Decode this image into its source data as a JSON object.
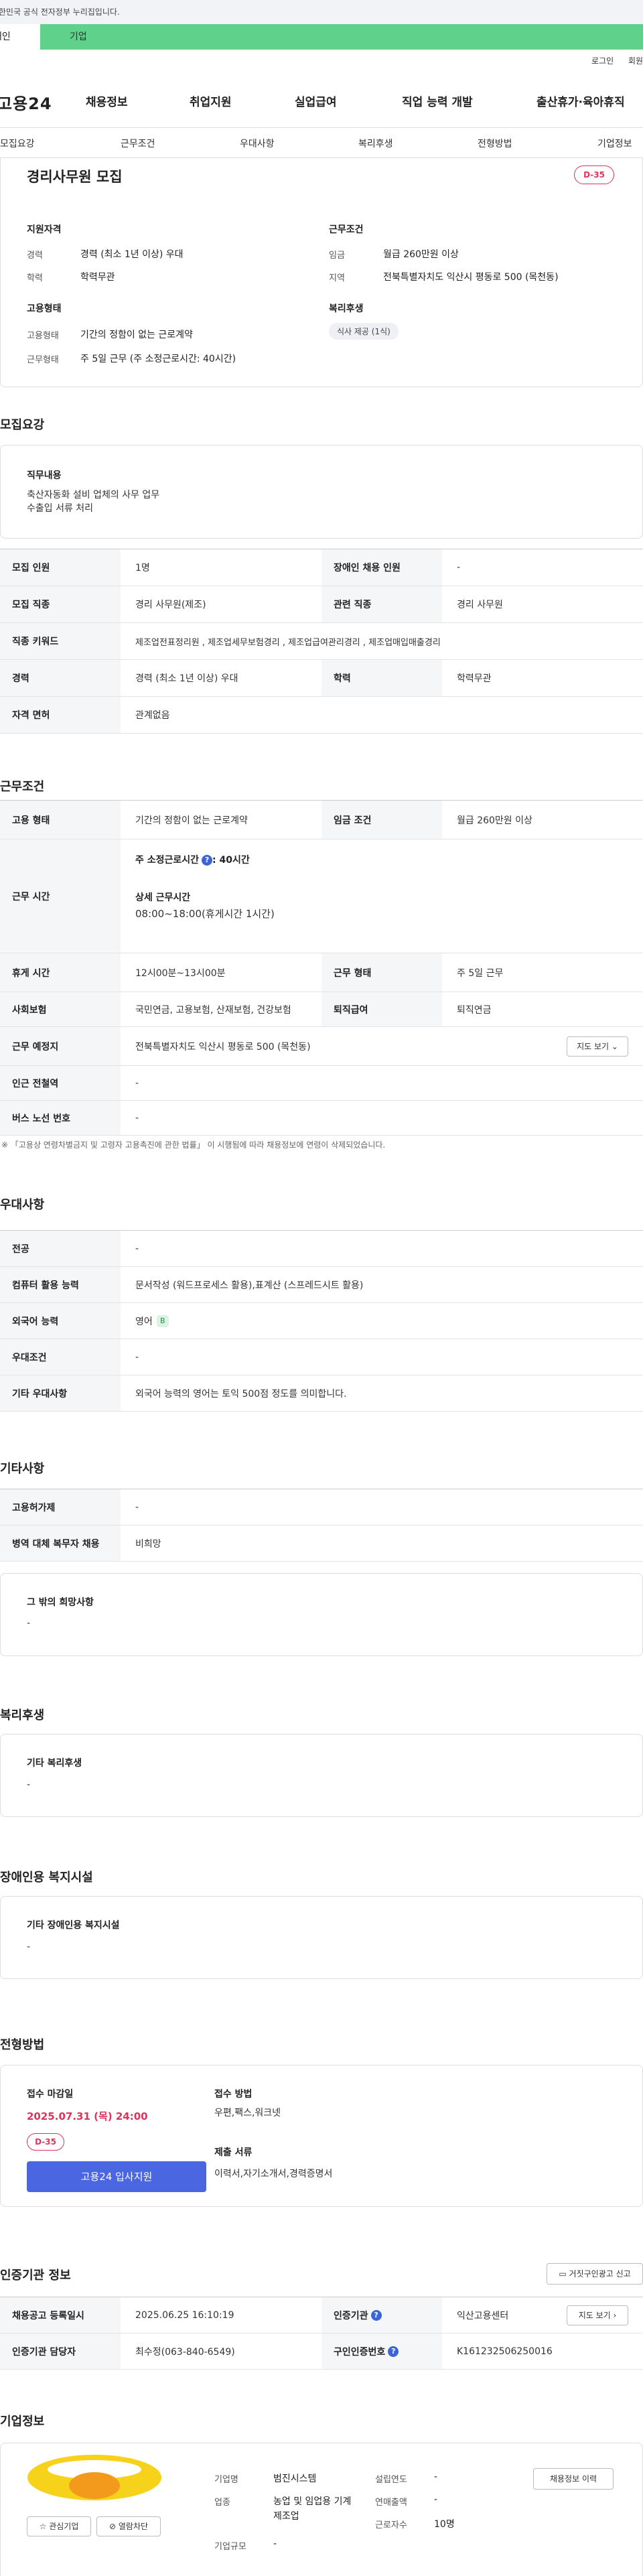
{
  "gov_bar": {
    "text": "이 누리집은 대한민국 공식 전자정부 누리집입니다."
  },
  "user_tabs": {
    "individual": "개인",
    "corporate": "기업"
  },
  "util": {
    "login": "로그인",
    "join": "회원가입"
  },
  "logo": "고용24",
  "gnb": [
    "채용정보",
    "취업지원",
    "실업급여",
    "직업 능력 개발",
    "출산휴가·육아휴직"
  ],
  "section_nav": [
    "모집요강",
    "근무조건",
    "우대사항",
    "복리후생",
    "전형방법",
    "기업정보"
  ],
  "summary": {
    "title": "경리사무원 모집",
    "dday": "D-35",
    "qual_head": "지원자격",
    "career_k": "경력",
    "career_v": "경력 (최소 1년 이상) 우대",
    "edu_k": "학력",
    "edu_v": "학력무관",
    "type_head": "고용형태",
    "emp_k": "고용형태",
    "emp_v": "기간의 정함이 없는 근로계약",
    "work_k": "근무형태",
    "work_v": "주 5일 근무 (주 소정근로시간: 40시간)",
    "cond_head": "근무조건",
    "wage_k": "임금",
    "wage_v": "월급 260만원 이상",
    "region_k": "지역",
    "region_v": "전북특별자치도 익산시 평동로 500 (목천동)",
    "welfare_head": "복리후생",
    "welfare_chip": "식사 제공 (1식)"
  },
  "recruit": {
    "heading": "모집요강",
    "duty_title": "직무내용",
    "duty_lines": [
      "축산자동화 설비 업체의 사무 업무",
      "수출입 서류 처리"
    ],
    "rows": [
      {
        "k1": "모집 인원",
        "v1": "1명",
        "k2": "장애인 채용 인원",
        "v2": "-"
      },
      {
        "k1": "모집 직종",
        "v1": "경리 사무원(제조)",
        "k2": "관련 직종",
        "v2": "경리 사무원"
      },
      {
        "k1": "직종 키워드",
        "v1": "제조업전표정리원 , 제조업세무보험경리 , 제조업급여관리경리 , 제조업매입매출경리"
      },
      {
        "k1": "경력",
        "v1": "경력 (최소 1년 이상) 우대",
        "k2": "학력",
        "v2": "학력무관"
      },
      {
        "k1": "자격 면허",
        "v1": "관계없음"
      }
    ]
  },
  "conditions": {
    "heading": "근무조건",
    "r1": {
      "k1": "고용 형태",
      "v1": "기간의 정함이 없는 근로계약",
      "k2": "임금 조건",
      "v2": "월급 260만원 이상"
    },
    "hours": {
      "k": "근무 시간",
      "weekly_label": "주 소정근로시간",
      "weekly_value": ": 40시간",
      "detail_label": "상세 근무시간",
      "detail_value": "08:00~18:00(휴게시간 1시간)"
    },
    "r3": {
      "k1": "휴게 시간",
      "v1": "12시00분~13시00분",
      "k2": "근무 형태",
      "v2": "주 5일 근무"
    },
    "r4": {
      "k1": "사회보험",
      "v1": "국민연금, 고용보험, 산재보험, 건강보험",
      "k2": "퇴직급여",
      "v2": "퇴직연금"
    },
    "r5": {
      "k": "근무 예정지",
      "v": "전북특별자치도 익산시 평동로 500 (목천동)",
      "btn": "지도 보기"
    },
    "r6": {
      "k": "인근 전철역",
      "v": "-"
    },
    "r7": {
      "k": "버스 노선 번호",
      "v": "-"
    },
    "note": "※ 「고용상 연령차별금지 및 고령자 고용촉진에 관한 법률」 이 시행됨에 따라 채용정보에 연령이 삭제되었습니다."
  },
  "preference": {
    "heading": "우대사항",
    "rows": [
      {
        "k": "전공",
        "v": "-"
      },
      {
        "k": "컴퓨터 활용 능력",
        "v": "문서작성 (워드프로세스 활용),표계산 (스프레드시트 활용)"
      },
      {
        "k": "외국어 능력",
        "v": "영어",
        "badge": "B"
      },
      {
        "k": "우대조건",
        "v": "-"
      },
      {
        "k": "기타 우대사항",
        "v": "외국어 능력의 영어는 토익 500점 정도를 의미합니다."
      }
    ]
  },
  "other": {
    "heading": "기타사항",
    "rows": [
      {
        "k": "고용허가제",
        "v": "-"
      },
      {
        "k": "병역 대체 복무자 채용",
        "v": "비희망"
      }
    ],
    "box_title": "그 밖의 희망사항",
    "box_value": "-"
  },
  "welfare": {
    "heading": "복리후생",
    "box_title": "기타 복리후생",
    "box_value": "-"
  },
  "disability": {
    "heading": "장애인용 복지시설",
    "box_title": "기타 장애인용 복지시설",
    "box_value": "-"
  },
  "selection": {
    "heading": "전형방법",
    "deadline_label": "접수 마감일",
    "deadline": "2025.07.31 (목) 24:00",
    "dday": "D-35",
    "apply_btn": "고용24 입사지원",
    "method_label": "접수 방법",
    "method": "우편,팩스,워크넷",
    "docs_label": "제출 서류",
    "docs": "이력서,자기소개서,경력증명서"
  },
  "agency": {
    "heading": "인증기관 정보",
    "report_btn": "거짓구인광고 신고",
    "r1": {
      "k1": "채용공고 등록일시",
      "v1": "2025.06.25 16:10:19",
      "k2": "인증기관",
      "v2": "익산고용센터",
      "btn": "지도 보기"
    },
    "r2": {
      "k1": "인증기관 담당자",
      "v1": "최수정(063-840-6549)",
      "k2": "구인인증번호",
      "v2": "K161232506250016"
    }
  },
  "company": {
    "heading": "기업정보",
    "fav_btn": "관심기업",
    "hide_btn": "열람차단",
    "history_btn": "채용정보 이력",
    "name_k": "기업명",
    "name_v": "범진시스템",
    "industry_k": "업종",
    "industry_v": "농업 및 임업용 기계 제조업",
    "size_k": "기업규모",
    "size_v": "-",
    "founded_k": "설립연도",
    "founded_v": "-",
    "sales_k": "연매출액",
    "sales_v": "-",
    "staff_k": "근로자수",
    "staff_v": "10명"
  },
  "colors": {
    "green": "#5fd18a",
    "accent_blue": "#4a66e0",
    "dday_red": "#e0325a",
    "logo_yellow": "#f7d21b",
    "logo_orange": "#f39a1c"
  }
}
